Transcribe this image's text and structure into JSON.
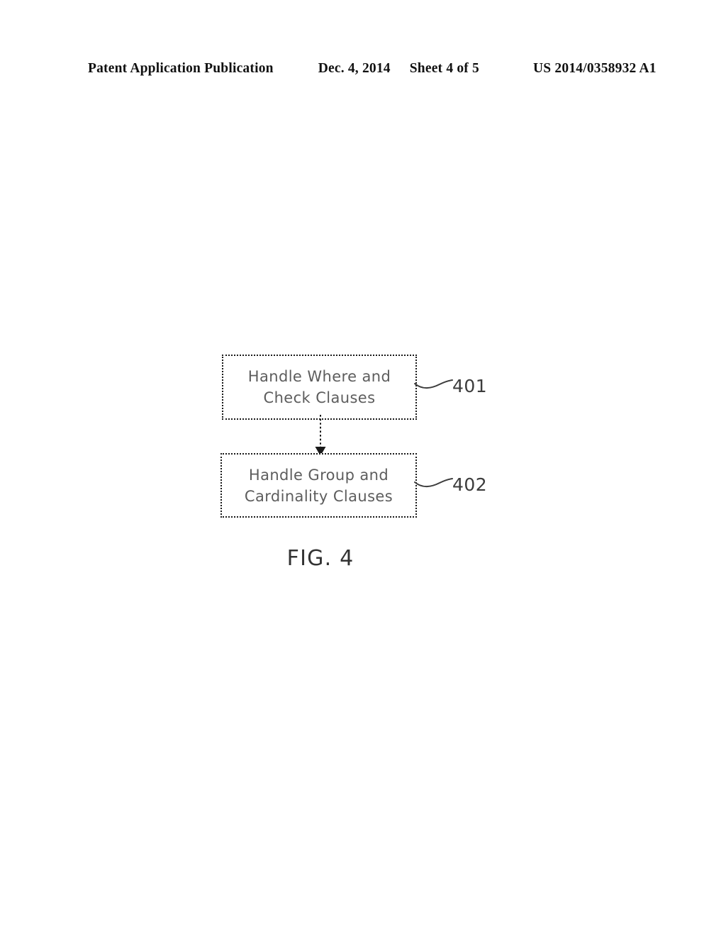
{
  "header": {
    "publication_label": "Patent Application Publication",
    "date": "Dec. 4, 2014",
    "sheet": "Sheet 4 of 5",
    "publication_number": "US 2014/0358932 A1"
  },
  "figure": {
    "caption": "FIG. 4",
    "boxes": [
      {
        "ref": "401",
        "line1": "Handle Where and",
        "line2": "Check Clauses"
      },
      {
        "ref": "402",
        "line1": "Handle Group and",
        "line2": "Cardinality Clauses"
      }
    ],
    "connector": {
      "style": "dotted",
      "arrowhead": "down-triangle"
    }
  },
  "colors": {
    "ink": "#1a1a1a",
    "box_text": "#5d5d5d",
    "ref_text": "#3c3c3c",
    "paper": "#ffffff"
  }
}
